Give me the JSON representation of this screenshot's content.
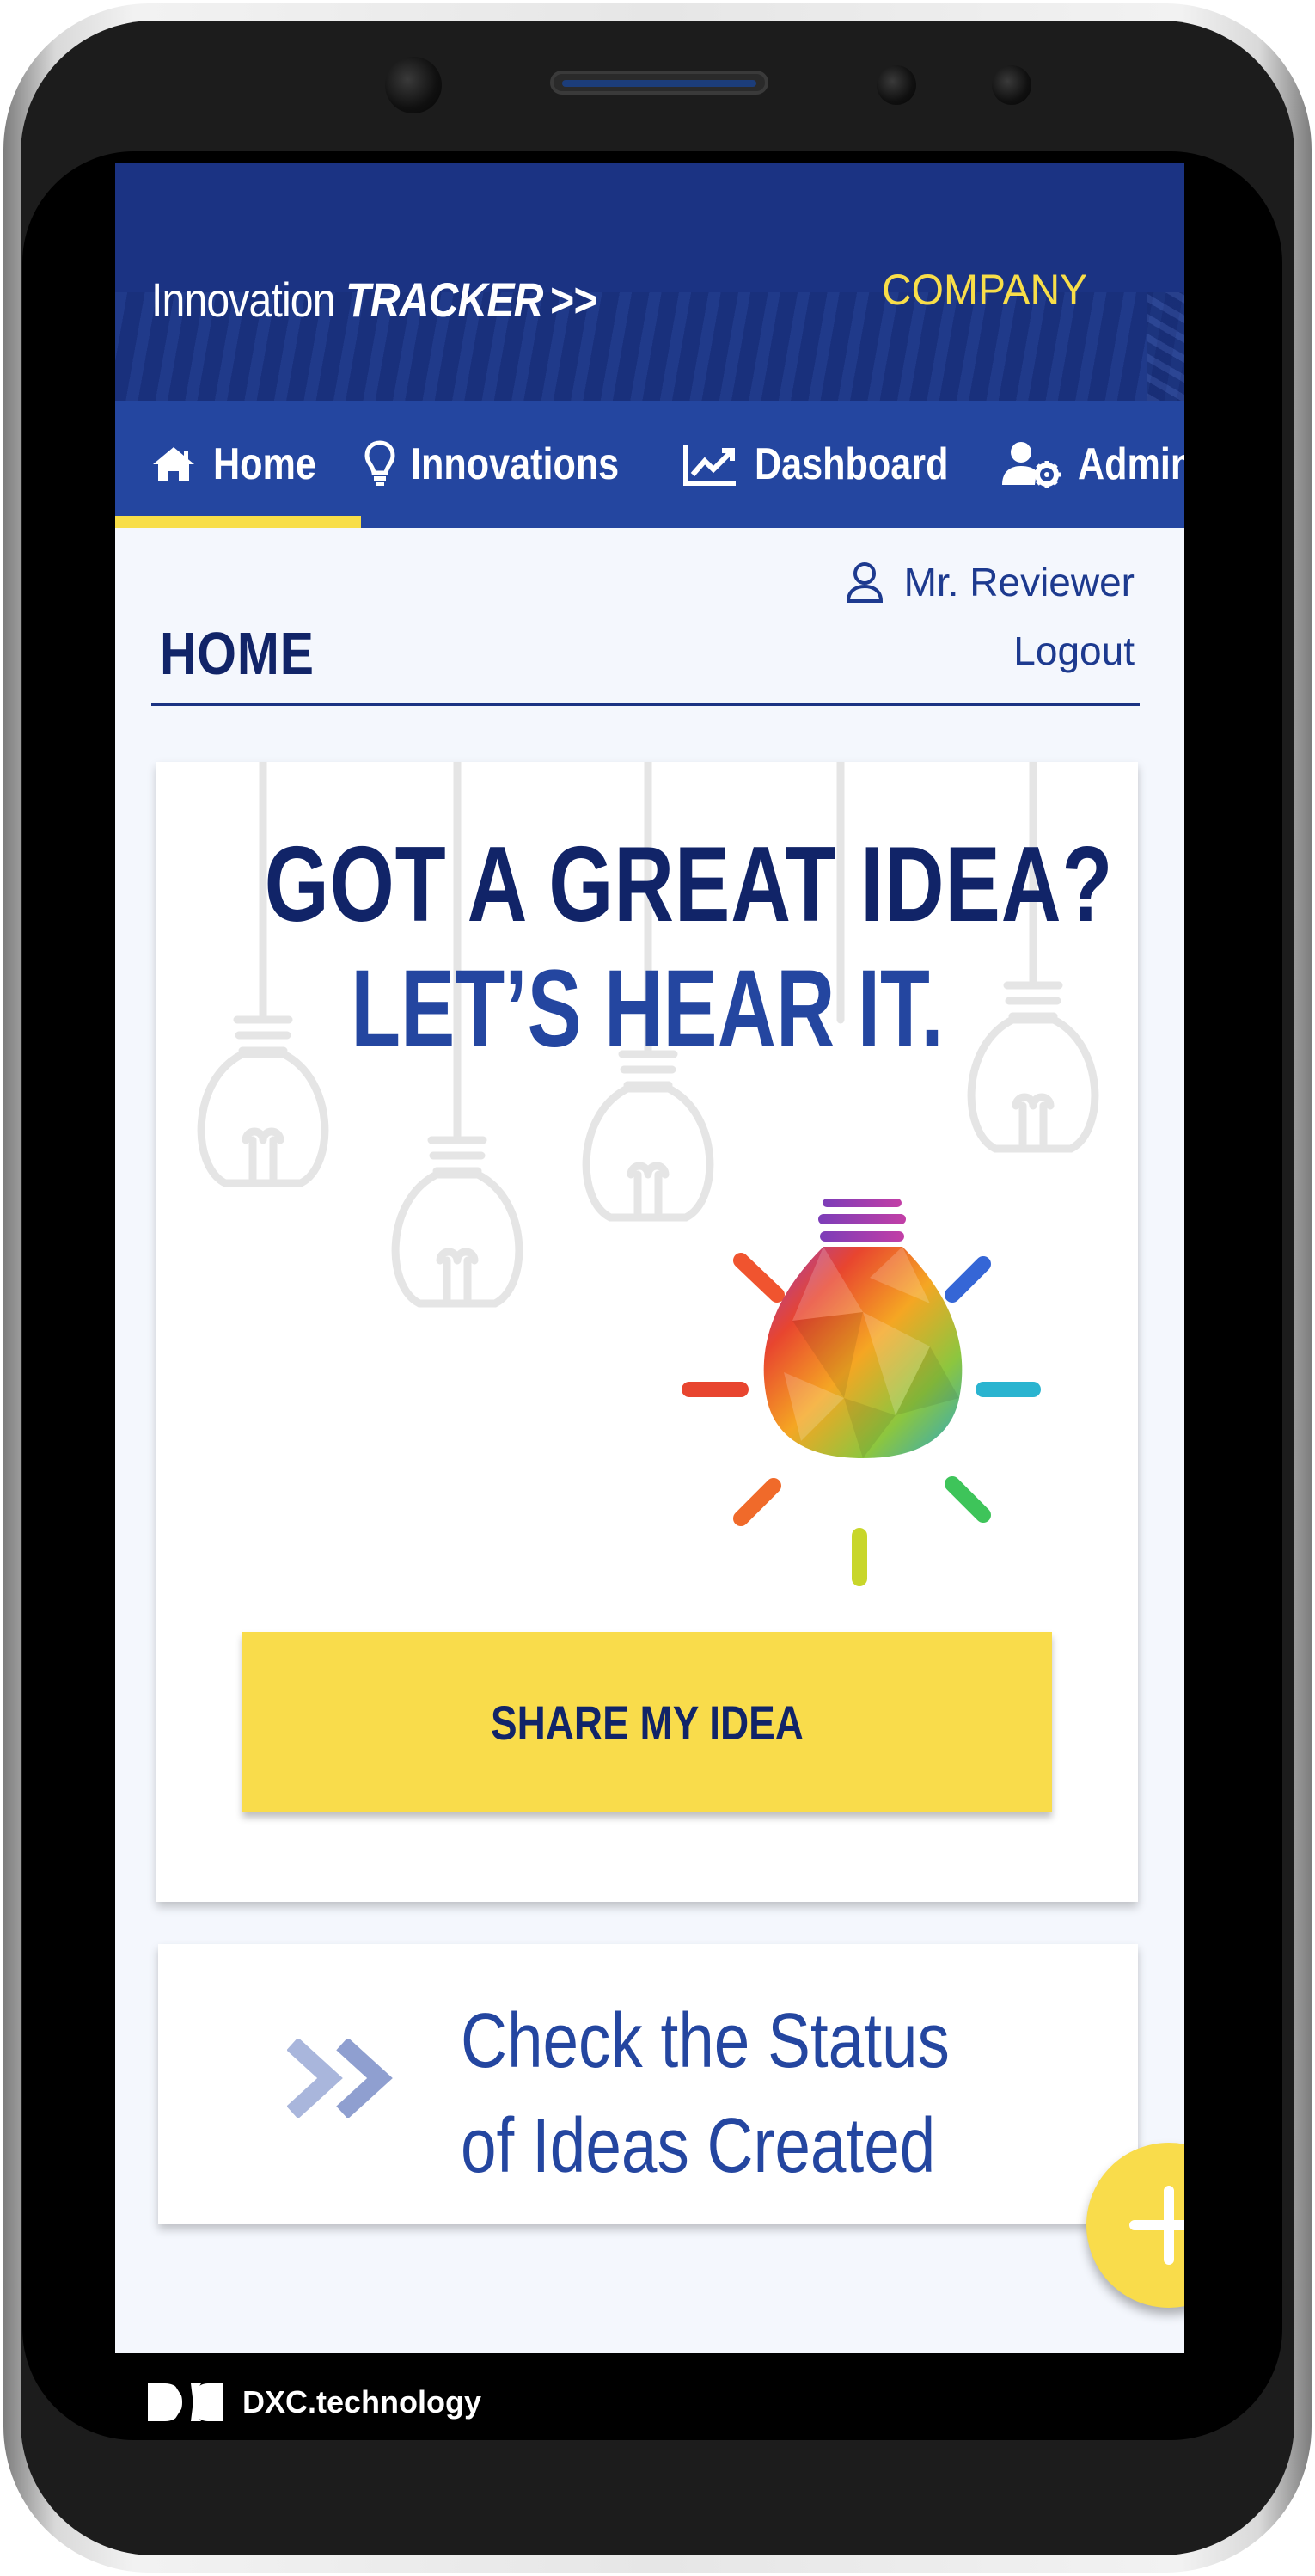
{
  "app": {
    "title_prefix": "Innovation ",
    "title_emphasis": "TRACKER",
    "title_arrows": ">>",
    "company": "COMPANY"
  },
  "nav": {
    "items": [
      {
        "label": "Home",
        "icon": "home-icon",
        "active": true
      },
      {
        "label": "Innovations",
        "icon": "lightbulb-icon",
        "active": false
      },
      {
        "label": "Dashboard",
        "icon": "chart-line-icon",
        "active": false
      },
      {
        "label": "Admin",
        "icon": "users-cog-icon",
        "active": false
      }
    ],
    "active_color": "#f8de49"
  },
  "user": {
    "name": "Mr. Reviewer",
    "logout": "Logout"
  },
  "page": {
    "title": "HOME"
  },
  "idea_card": {
    "headline_1": "GOT A GREAT IDEA?",
    "headline_2": "LET’S HEAR IT.",
    "button": "SHARE MY IDEA"
  },
  "status_card": {
    "line_1": "Check the Status",
    "line_2": "of Ideas Created"
  },
  "fab": {
    "icon": "plus-icon"
  },
  "footer": {
    "brand": "DXC.technology"
  },
  "colors": {
    "header": "#1b3383",
    "nav": "#2446a0",
    "accent": "#f9dc4b",
    "text_dark": "#112468"
  }
}
